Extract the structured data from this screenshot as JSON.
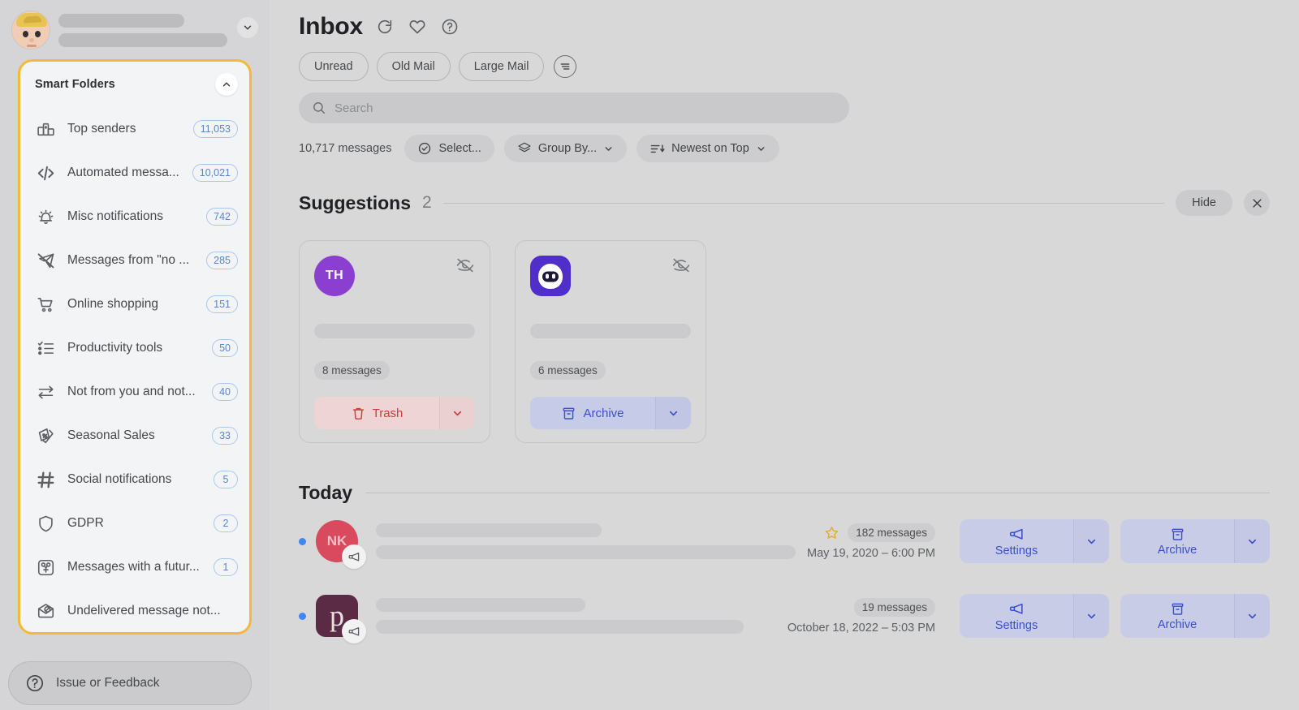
{
  "colors": {
    "accent_yellow": "#f5b93a",
    "badge_blue": "#5b87c9",
    "unread_blue": "#4285f4",
    "action_blue": "#3b4ed0",
    "trash_red": "#d1393b",
    "star_gold": "#e2ac33",
    "app_background": "#d8d8d8",
    "sidebar_background": "#d5d5d7",
    "panel_background": "#f3f4f6"
  },
  "sidebar": {
    "account": {
      "avatar_icon": "memoji-avatar",
      "name_redacted": true,
      "email_redacted": true,
      "chevron_icon": "chevron-down-icon"
    },
    "smart_folders": {
      "title": "Smart Folders",
      "collapse_icon": "chevron-up-icon",
      "items": [
        {
          "label": "Top senders",
          "count": "11,053",
          "icon": "podium-icon"
        },
        {
          "label": "Automated messa...",
          "count": "10,021",
          "icon": "code-brackets-icon"
        },
        {
          "label": "Misc notifications",
          "count": "742",
          "icon": "bell-ringing-icon"
        },
        {
          "label": "Messages from \"no ...",
          "count": "285",
          "icon": "send-off-icon"
        },
        {
          "label": "Online shopping",
          "count": "151",
          "icon": "shopping-cart-icon"
        },
        {
          "label": "Productivity tools",
          "count": "50",
          "icon": "checklist-icon"
        },
        {
          "label": "Not from you and not...",
          "count": "40",
          "icon": "transfer-arrows-icon"
        },
        {
          "label": "Seasonal Sales",
          "count": "33",
          "icon": "price-tag-icon"
        },
        {
          "label": "Social notifications",
          "count": "5",
          "icon": "hashtag-icon"
        },
        {
          "label": "GDPR",
          "count": "2",
          "icon": "shield-icon"
        },
        {
          "label": "Messages with a futur...",
          "count": "1",
          "icon": "future-date-icon"
        },
        {
          "label": "Undelivered message not...",
          "count": "",
          "icon": "undelivered-mail-icon"
        }
      ]
    },
    "feedback": {
      "label": "Issue or Feedback",
      "icon": "question-circle-icon"
    }
  },
  "header": {
    "title": "Inbox",
    "icons": [
      {
        "name": "refresh-icon"
      },
      {
        "name": "heart-icon"
      },
      {
        "name": "help-circle-icon"
      }
    ],
    "filter_pills": [
      "Unread",
      "Old Mail",
      "Large Mail"
    ],
    "filter_settings_icon": "filter-icon",
    "search": {
      "placeholder": "Search",
      "value": "",
      "icon": "search-icon"
    },
    "message_count": "10,717 messages",
    "tools": [
      {
        "label": "Select...",
        "icon": "check-circle-icon",
        "has_caret": false
      },
      {
        "label": "Group By...",
        "icon": "layers-icon",
        "has_caret": true
      },
      {
        "label": "Newest on Top",
        "icon": "sort-descending-icon",
        "has_caret": true
      }
    ]
  },
  "suggestions": {
    "title": "Suggestions",
    "count": "2",
    "hide_label": "Hide",
    "close_icon": "close-icon",
    "cards": [
      {
        "avatar_kind": "initials",
        "avatar_text": "TH",
        "avatar_color": "#8b3fd1",
        "mute_icon": "eye-off-icon",
        "subject_redacted": true,
        "messages": "8 messages",
        "action_label": "Trash",
        "action_icon": "trash-icon",
        "action_kind": "trash",
        "caret_icon": "chevron-down-icon"
      },
      {
        "avatar_kind": "logo",
        "avatar_text": "",
        "avatar_color": "#4f2ecb",
        "mute_icon": "eye-off-icon",
        "subject_redacted": true,
        "messages": "6 messages",
        "action_label": "Archive",
        "action_icon": "archive-icon",
        "action_kind": "archive",
        "caret_icon": "chevron-down-icon"
      }
    ]
  },
  "today": {
    "title": "Today",
    "rows": [
      {
        "unread": true,
        "avatar_kind": "initials",
        "avatar_text": "NK",
        "avatar_color": "#d94a5e",
        "badge_icon": "megaphone-icon",
        "starred": true,
        "star_icon": "star-icon",
        "messages": "182 messages",
        "date": "May 19, 2020 – 6:00 PM",
        "actions": [
          {
            "label": "Settings",
            "icon": "megaphone-icon",
            "caret_icon": "chevron-down-icon"
          },
          {
            "label": "Archive",
            "icon": "archive-icon",
            "caret_icon": "chevron-down-icon"
          }
        ]
      },
      {
        "unread": true,
        "avatar_kind": "letter",
        "avatar_text": "p",
        "avatar_color": "#5b2a45",
        "badge_icon": "megaphone-icon",
        "starred": false,
        "star_icon": "",
        "messages": "19 messages",
        "date": "October 18, 2022 – 5:03 PM",
        "actions": [
          {
            "label": "Settings",
            "icon": "megaphone-icon",
            "caret_icon": "chevron-down-icon"
          },
          {
            "label": "Archive",
            "icon": "archive-icon",
            "caret_icon": "chevron-down-icon"
          }
        ]
      }
    ]
  }
}
